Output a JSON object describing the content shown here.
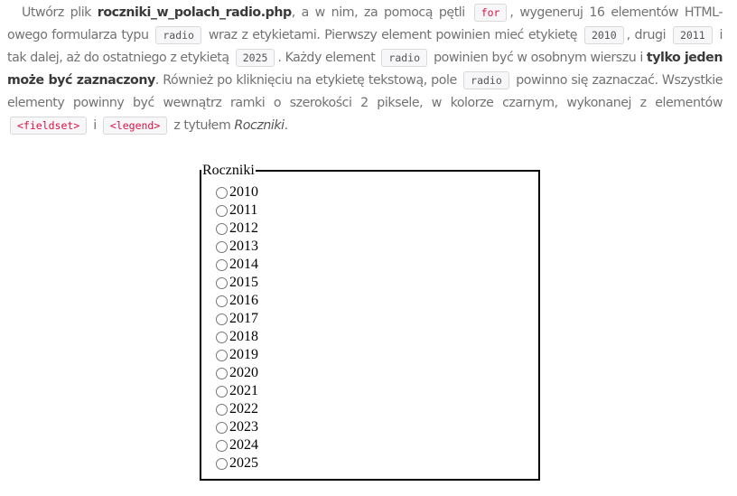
{
  "task": {
    "t1": "Utwórz plik ",
    "filename": "roczniki_w_polach_radio.php",
    "t2": ", a w nim, za pomocą pętli ",
    "code_for": "for",
    "t3": ", wygeneruj 16 elementów HTML-owego formularza typu ",
    "code_radio1": "radio",
    "t4": " wraz z etykietami. Pierwszy element powinien mieć etykietę ",
    "code_2010": "2010",
    "t5": ", drugi ",
    "code_2011": "2011",
    "t6": " i tak dalej, aż do ostatniego z etykietą ",
    "code_2025": "2025",
    "t7": ". Każdy element ",
    "code_radio2": "radio",
    "t8": " powinien być w osobnym wierszu i ",
    "bold_only_one": "tylko jeden może być zaznaczony",
    "t9": ". Również po kliknięciu na etykietę tekstową, pole ",
    "code_radio3": "radio",
    "t10": " powinno się zaznaczać. Wszystkie elementy powinny być wewnątrz ramki o szerokości 2 piksele, w kolorze czarnym, wykonanej z elementów ",
    "code_fieldset": "<fieldset>",
    "t11": " i ",
    "code_legend": "<legend>",
    "t12": " z tytułem ",
    "title_italic": "Roczniki",
    "t13": "."
  },
  "form": {
    "legend": "Roczniki",
    "options": [
      "2010",
      "2011",
      "2012",
      "2013",
      "2014",
      "2015",
      "2016",
      "2017",
      "2018",
      "2019",
      "2020",
      "2021",
      "2022",
      "2023",
      "2024",
      "2025"
    ]
  },
  "colors": {
    "text": "#727272",
    "code_pink": "#dd1144",
    "border": "#000000"
  }
}
